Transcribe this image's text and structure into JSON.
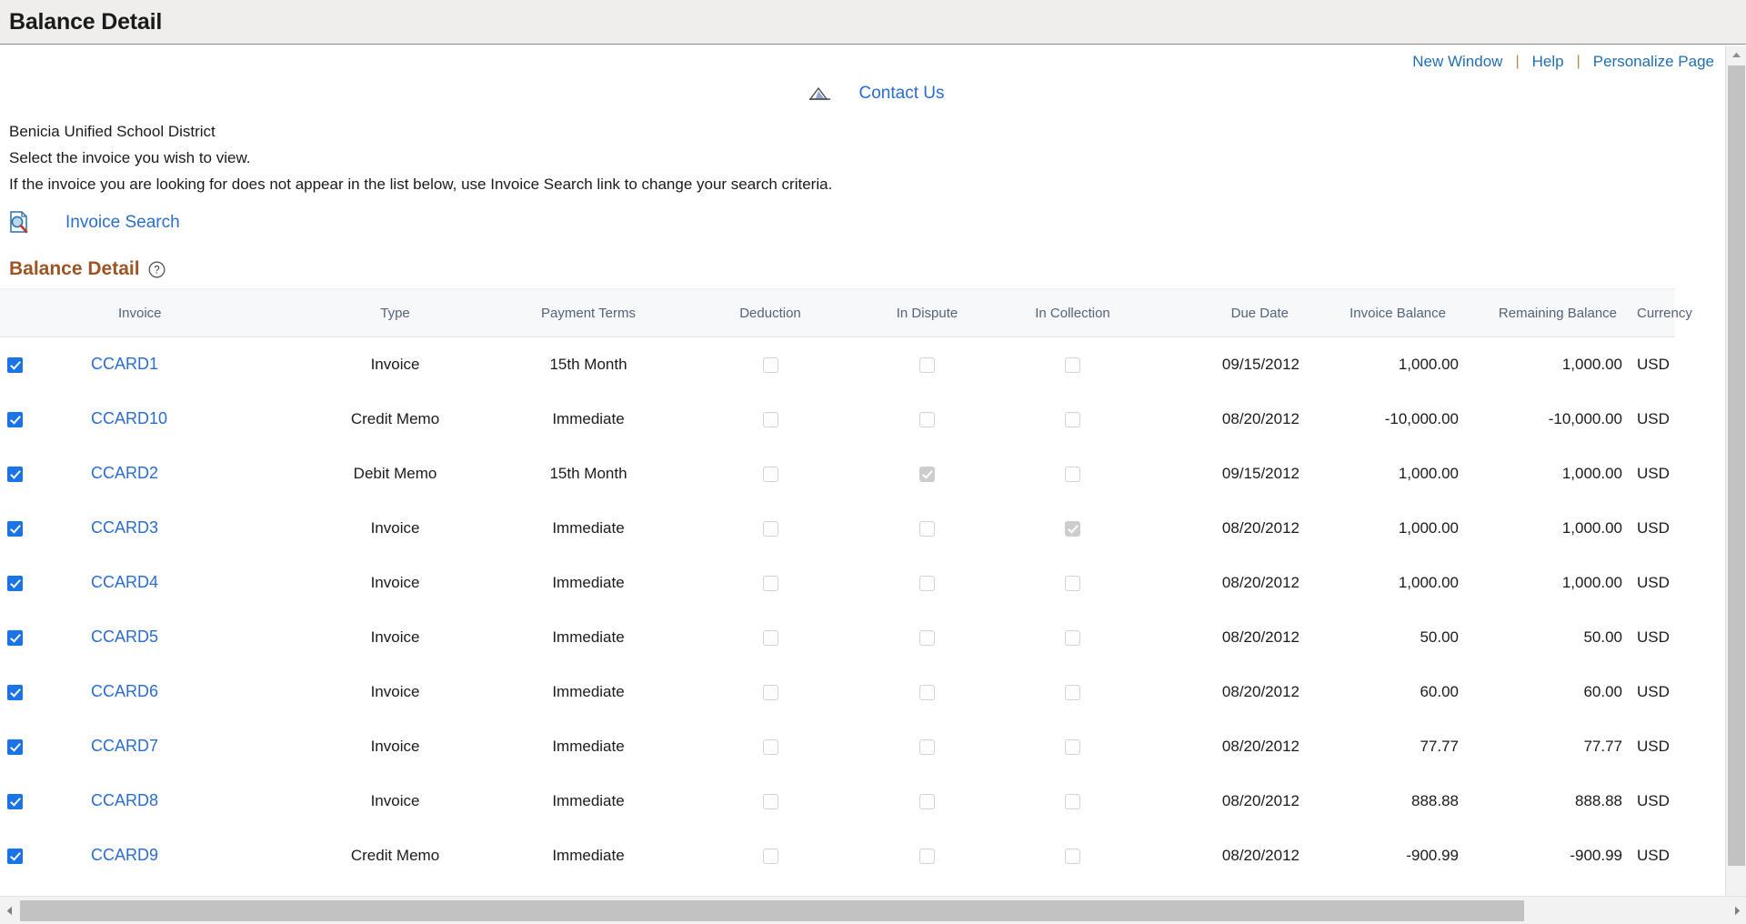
{
  "titlebar": {
    "title": "Balance Detail"
  },
  "toplinks": {
    "new_window": "New Window",
    "help": "Help",
    "personalize": "Personalize Page",
    "separator": "|"
  },
  "contact": {
    "icon": "contact-us-icon",
    "label": "Contact Us"
  },
  "intro": {
    "line1": "Benicia Unified School District",
    "line2": "Select the invoice you wish to view.",
    "line3": "If the invoice you are looking for does not appear in the list below, use Invoice Search link to change your search criteria."
  },
  "invoice_search": {
    "icon": "invoice-search-icon",
    "label": "Invoice Search"
  },
  "section": {
    "title": "Balance Detail",
    "help_icon": "help-circle-icon"
  },
  "grid": {
    "columns": {
      "select": "",
      "invoice": "Invoice",
      "type": "Type",
      "payment_terms": "Payment Terms",
      "deduction": "Deduction",
      "in_dispute": "In Dispute",
      "in_collection": "In Collection",
      "due_date": "Due Date",
      "invoice_balance": "Invoice Balance",
      "remaining_balance": "Remaining Balance",
      "currency": "Currency"
    },
    "rows": [
      {
        "selected": true,
        "invoice": "CCARD1",
        "type": "Invoice",
        "payment_terms": "15th Month",
        "deduction": false,
        "in_dispute": false,
        "in_collection": false,
        "due_date": "09/15/2012",
        "invoice_balance": "1,000.00",
        "remaining_balance": "1,000.00",
        "currency": "USD"
      },
      {
        "selected": true,
        "invoice": "CCARD10",
        "type": "Credit Memo",
        "payment_terms": "Immediate",
        "deduction": false,
        "in_dispute": false,
        "in_collection": false,
        "due_date": "08/20/2012",
        "invoice_balance": "-10,000.00",
        "remaining_balance": "-10,000.00",
        "currency": "USD"
      },
      {
        "selected": true,
        "invoice": "CCARD2",
        "type": "Debit Memo",
        "payment_terms": "15th Month",
        "deduction": false,
        "in_dispute": true,
        "in_collection": false,
        "due_date": "09/15/2012",
        "invoice_balance": "1,000.00",
        "remaining_balance": "1,000.00",
        "currency": "USD"
      },
      {
        "selected": true,
        "invoice": "CCARD3",
        "type": "Invoice",
        "payment_terms": "Immediate",
        "deduction": false,
        "in_dispute": false,
        "in_collection": true,
        "due_date": "08/20/2012",
        "invoice_balance": "1,000.00",
        "remaining_balance": "1,000.00",
        "currency": "USD"
      },
      {
        "selected": true,
        "invoice": "CCARD4",
        "type": "Invoice",
        "payment_terms": "Immediate",
        "deduction": false,
        "in_dispute": false,
        "in_collection": false,
        "due_date": "08/20/2012",
        "invoice_balance": "1,000.00",
        "remaining_balance": "1,000.00",
        "currency": "USD"
      },
      {
        "selected": true,
        "invoice": "CCARD5",
        "type": "Invoice",
        "payment_terms": "Immediate",
        "deduction": false,
        "in_dispute": false,
        "in_collection": false,
        "due_date": "08/20/2012",
        "invoice_balance": "50.00",
        "remaining_balance": "50.00",
        "currency": "USD"
      },
      {
        "selected": true,
        "invoice": "CCARD6",
        "type": "Invoice",
        "payment_terms": "Immediate",
        "deduction": false,
        "in_dispute": false,
        "in_collection": false,
        "due_date": "08/20/2012",
        "invoice_balance": "60.00",
        "remaining_balance": "60.00",
        "currency": "USD"
      },
      {
        "selected": true,
        "invoice": "CCARD7",
        "type": "Invoice",
        "payment_terms": "Immediate",
        "deduction": false,
        "in_dispute": false,
        "in_collection": false,
        "due_date": "08/20/2012",
        "invoice_balance": "77.77",
        "remaining_balance": "77.77",
        "currency": "USD"
      },
      {
        "selected": true,
        "invoice": "CCARD8",
        "type": "Invoice",
        "payment_terms": "Immediate",
        "deduction": false,
        "in_dispute": false,
        "in_collection": false,
        "due_date": "08/20/2012",
        "invoice_balance": "888.88",
        "remaining_balance": "888.88",
        "currency": "USD"
      },
      {
        "selected": true,
        "invoice": "CCARD9",
        "type": "Credit Memo",
        "payment_terms": "Immediate",
        "deduction": false,
        "in_dispute": false,
        "in_collection": false,
        "due_date": "08/20/2012",
        "invoice_balance": "-900.99",
        "remaining_balance": "-900.99",
        "currency": "USD"
      }
    ]
  },
  "scrollbars": {
    "horizontal_thumb_percent": 88,
    "vertical_thumb_percent": 94
  },
  "colors": {
    "link": "#2a6dd0",
    "toplink": "#1f6fb2",
    "section_title": "#9c5524",
    "header_text": "#56637a",
    "checkbox_on": "#1a73e8",
    "titlebar_bg": "#efeeec"
  }
}
